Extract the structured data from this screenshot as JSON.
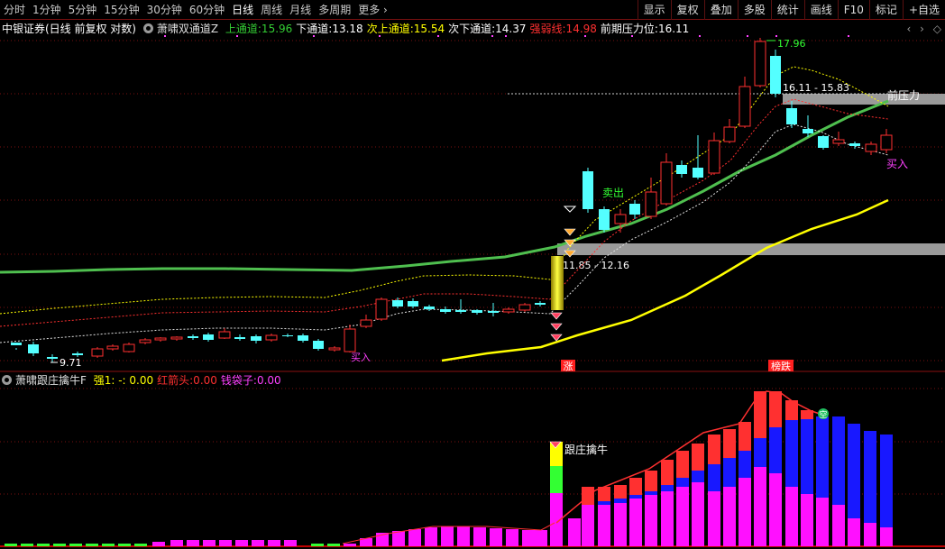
{
  "toolbar": {
    "periods": [
      "分时",
      "1分钟",
      "5分钟",
      "15分钟",
      "30分钟",
      "60分钟",
      "日线",
      "周线",
      "月线",
      "多周期",
      "更多"
    ],
    "active_period": "日线",
    "more_arrow": "chevron-right",
    "right_buttons": [
      "显示",
      "复权",
      "叠加",
      "多股",
      "统计",
      "画线",
      "F10",
      "标记",
      "+自选"
    ]
  },
  "main_header": {
    "stock": "中银证券(日线 前复权 对数)",
    "indicator": "萧啸双通道Z",
    "items": [
      {
        "label": "上通道:",
        "value": "15.96",
        "color": "#33cc33"
      },
      {
        "label": "下通道:",
        "value": "13.18",
        "color": "#ffffff"
      },
      {
        "label": "次上通道:",
        "value": "15.54",
        "color": "#ffff00"
      },
      {
        "label": "次下通道:",
        "value": "14.37",
        "color": "#ffffff"
      },
      {
        "label": "强弱线:",
        "value": "14.98",
        "color": "#ff3030"
      },
      {
        "label": "前期压力位:",
        "value": "16.11",
        "color": "#ffffff"
      }
    ],
    "icons": [
      "chevron-left-icon",
      "chevron-right-icon",
      "expand-icon"
    ]
  },
  "annotations": {
    "top_price": "17.96",
    "low_price": "9.71",
    "zone_upper": "16.11 - 15.83",
    "zone_lower": "11.85 - 12.16",
    "pressure_label": "前压力",
    "sell_label": "卖出",
    "buy_label": "买入",
    "buy_label_2": "买入",
    "zhang_label": "涨",
    "bang_label": "榜跌"
  },
  "sub_header": {
    "indicator": "萧啸跟庄擒牛F",
    "items": [
      {
        "label": "强1: -",
        "value": ": 0.00",
        "color": "#ffff00"
      },
      {
        "label": "红箭头:",
        "value": "0.00",
        "color": "#ff3030"
      },
      {
        "label": "钱袋子:",
        "value": "0.00",
        "color": "#ff40ff"
      }
    ],
    "signal_label": "跟庄擒牛",
    "bag_label": "空"
  },
  "colors": {
    "up": "#ff3030",
    "down": "#54ffff",
    "channel_green": "#4fbf4f",
    "channel_yellow": "#ffff00",
    "grid": "#7a1010",
    "blue": "#1818ff",
    "magenta": "#ff10ff"
  }
}
